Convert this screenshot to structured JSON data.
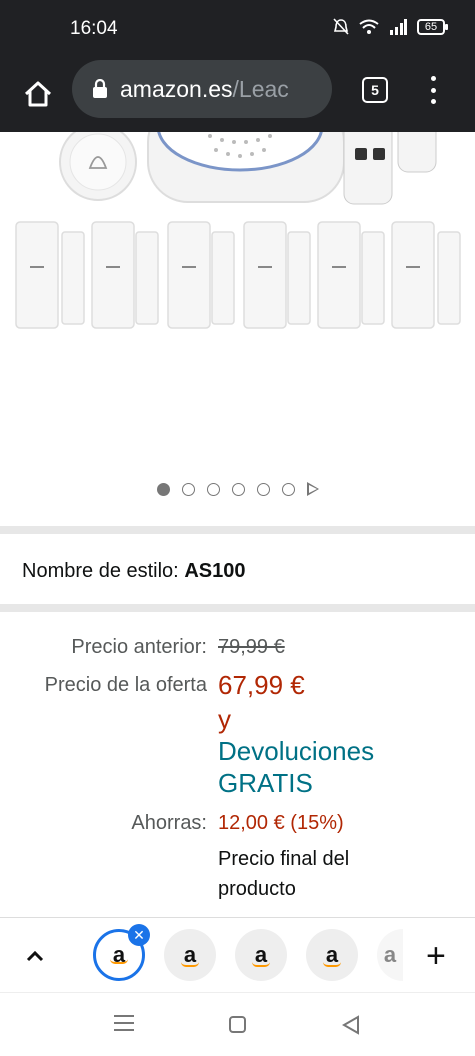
{
  "status_bar": {
    "time": "16:04",
    "battery": "65"
  },
  "browser": {
    "url_domain": "amazon.es",
    "url_path": "/Leac",
    "tab_count": "5"
  },
  "carousel": {
    "total_dots": 6,
    "active_index": 0
  },
  "style": {
    "label": "Nombre de estilo:",
    "value": "AS100"
  },
  "pricing": {
    "previous_label": "Precio anterior:",
    "previous_value": "79,99 €",
    "offer_label": "Precio de la oferta",
    "offer_value": "67,99 €",
    "and": "y",
    "returns_line1": "Devoluciones",
    "returns_line2": "GRATIS",
    "savings_label": "Ahorras:",
    "savings_value": "12,00 € (15%)",
    "final_line1": "Precio final del",
    "final_line2": "producto"
  },
  "tabstrip": {
    "tabs": [
      {
        "glyph": "a",
        "active": true
      },
      {
        "glyph": "a",
        "active": false
      },
      {
        "glyph": "a",
        "active": false
      },
      {
        "glyph": "a",
        "active": false
      },
      {
        "glyph": "a",
        "active": false
      }
    ],
    "close_glyph": "✕",
    "add_glyph": "+"
  },
  "colors": {
    "accent": "#1a73e8",
    "price_red": "#b12704",
    "link_teal": "#007185"
  }
}
